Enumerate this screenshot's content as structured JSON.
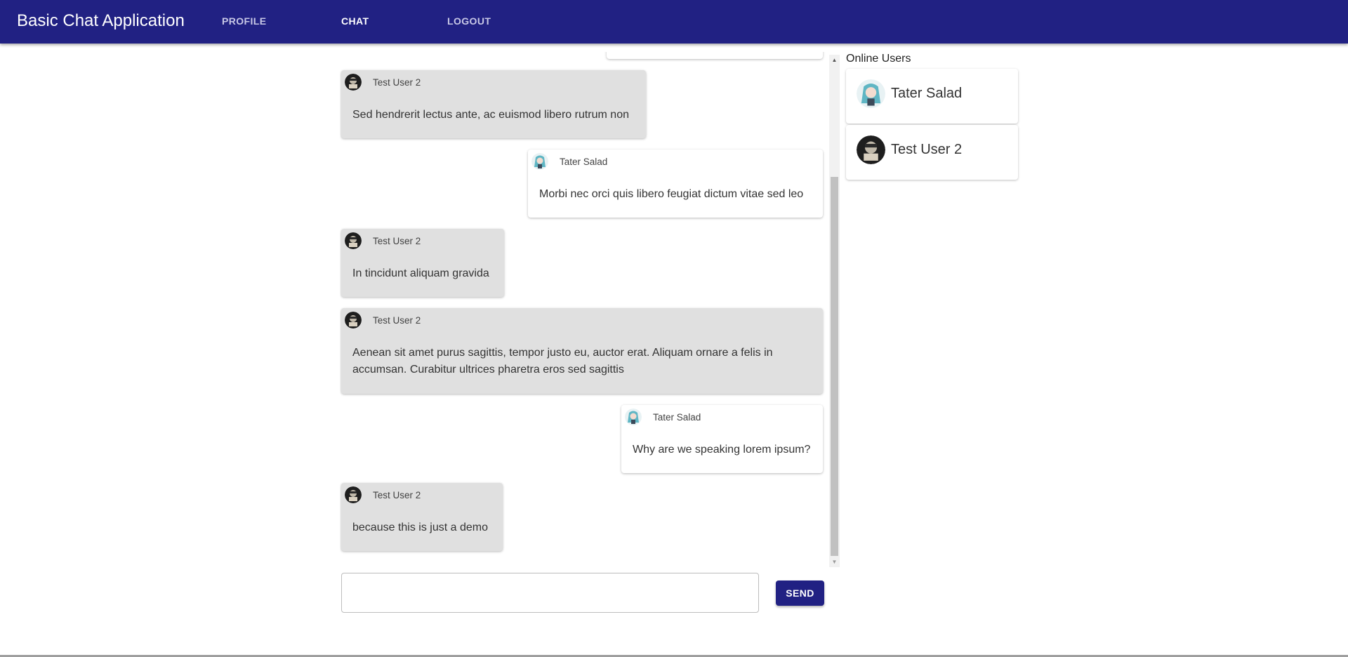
{
  "app": {
    "title": "Basic Chat Application",
    "accent_color": "#212183"
  },
  "nav": {
    "items": [
      {
        "label": "PROFILE",
        "active": false
      },
      {
        "label": "CHAT",
        "active": true
      },
      {
        "label": "LOGOUT",
        "active": false
      }
    ]
  },
  "messages": [
    {
      "author": "Test User 2",
      "text": "Sed hendrerit lectus ante, ac euismod libero rutrum non",
      "from_self": false,
      "avatar": "dark-avatar-icon"
    },
    {
      "author": "Tater Salad",
      "text": "Morbi nec orci quis libero feugiat dictum vitae sed leo",
      "from_self": true,
      "avatar": "anime-avatar-icon"
    },
    {
      "author": "Test User 2",
      "text": "In tincidunt aliquam gravida",
      "from_self": false,
      "avatar": "dark-avatar-icon"
    },
    {
      "author": "Test User 2",
      "text": "Aenean sit amet purus sagittis, tempor justo eu, auctor erat. Aliquam ornare a felis in accumsan. Curabitur ultrices pharetra eros sed sagittis",
      "from_self": false,
      "avatar": "dark-avatar-icon"
    },
    {
      "author": "Tater Salad",
      "text": "Why are we speaking lorem ipsum?",
      "from_self": true,
      "avatar": "anime-avatar-icon"
    },
    {
      "author": "Test User 2",
      "text": "because this is just a demo",
      "from_self": false,
      "avatar": "dark-avatar-icon"
    }
  ],
  "composer": {
    "value": "",
    "placeholder": "",
    "send_label": "SEND"
  },
  "online_users": {
    "title": "Online Users",
    "users": [
      {
        "name": "Tater Salad",
        "avatar": "anime-avatar-icon"
      },
      {
        "name": "Test User 2",
        "avatar": "dark-avatar-icon"
      }
    ]
  },
  "colors": {
    "other_bubble": "#e0e0e0",
    "self_bubble": "#ffffff"
  }
}
